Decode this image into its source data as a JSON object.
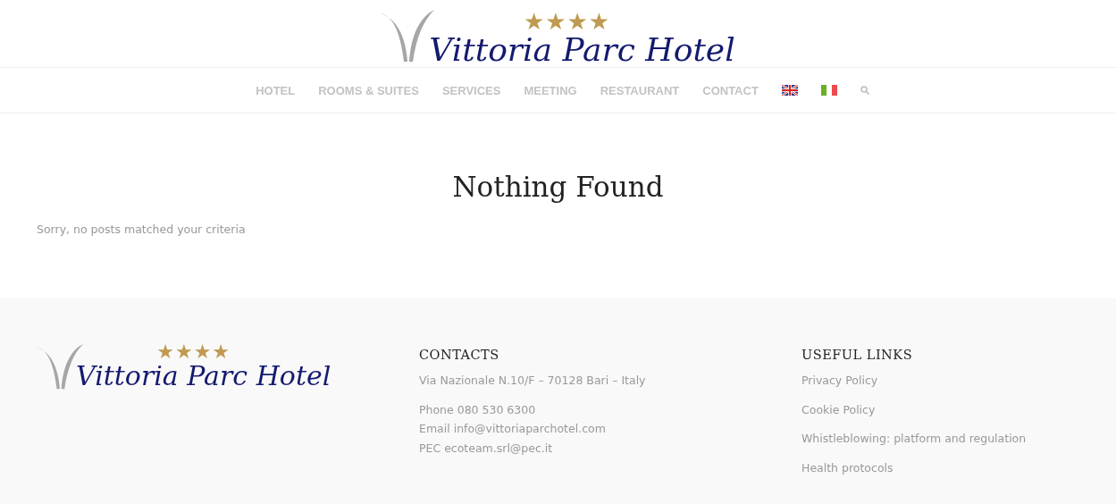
{
  "header": {
    "logo": {
      "stars": "★★★★",
      "name": "Vittoria Parc Hotel"
    }
  },
  "nav": {
    "items": [
      {
        "label": "HOTEL"
      },
      {
        "label": "ROOMS & SUITES"
      },
      {
        "label": "SERVICES"
      },
      {
        "label": "MEETING"
      },
      {
        "label": "RESTAURANT"
      },
      {
        "label": "CONTACT"
      }
    ],
    "languages": [
      {
        "kind": "uk"
      },
      {
        "kind": "it"
      }
    ]
  },
  "main": {
    "title": "Nothing Found",
    "message": "Sorry, no posts matched your criteria"
  },
  "footer": {
    "logo": {
      "stars": "★★★★",
      "name": "Vittoria Parc Hotel"
    },
    "contacts": {
      "heading": "CONTACTS",
      "address": "Via Nazionale N.10/F – 70128 Bari – Italy",
      "lines": [
        "Phone 080 530 6300",
        "Email info@vittoriaparchotel.com",
        "PEC ecoteam.srl@pec.it"
      ]
    },
    "useful_links": {
      "heading": "USEFUL LINKS",
      "links": [
        "Privacy Policy",
        "Cookie Policy",
        "Whistleblowing: platform and regulation",
        "Health protocols"
      ]
    }
  }
}
